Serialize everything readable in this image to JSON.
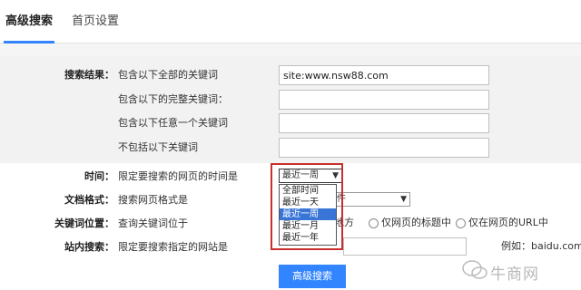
{
  "tabs": {
    "active": "高级搜索",
    "other": "首页设置"
  },
  "results": {
    "label": "搜索结果：",
    "rows": [
      {
        "desc": "包含以下全部的关键词",
        "value": "site:www.nsw88.com"
      },
      {
        "desc": "包含以下的完整关键词：",
        "value": ""
      },
      {
        "desc": "包含以下任意一个关键词",
        "value": ""
      },
      {
        "desc": "不包括以下关键词",
        "value": ""
      }
    ]
  },
  "time": {
    "label": "时间：",
    "desc": "限定要搜索的网页的时间是",
    "selected": "最近一周",
    "options": [
      "全部时间",
      "最近一天",
      "最近一周",
      "最近一月",
      "最近一年"
    ]
  },
  "format": {
    "label": "文档格式：",
    "desc": "搜索网页格式是",
    "selected_suffix": "件"
  },
  "position": {
    "label": "关键词位置：",
    "desc": "查询关键词位于",
    "options": [
      "地方",
      "仅网页的标题中",
      "仅在网页的URL中"
    ]
  },
  "site": {
    "label": "站内搜索：",
    "desc": "限定要搜索指定的网站是",
    "example": "例如：baidu.com"
  },
  "submit_label": "高级搜索",
  "watermark": "牛商网",
  "colors": {
    "accent": "#3385ff",
    "highlight": "#c9302c",
    "selected_option": "#3875d7"
  }
}
